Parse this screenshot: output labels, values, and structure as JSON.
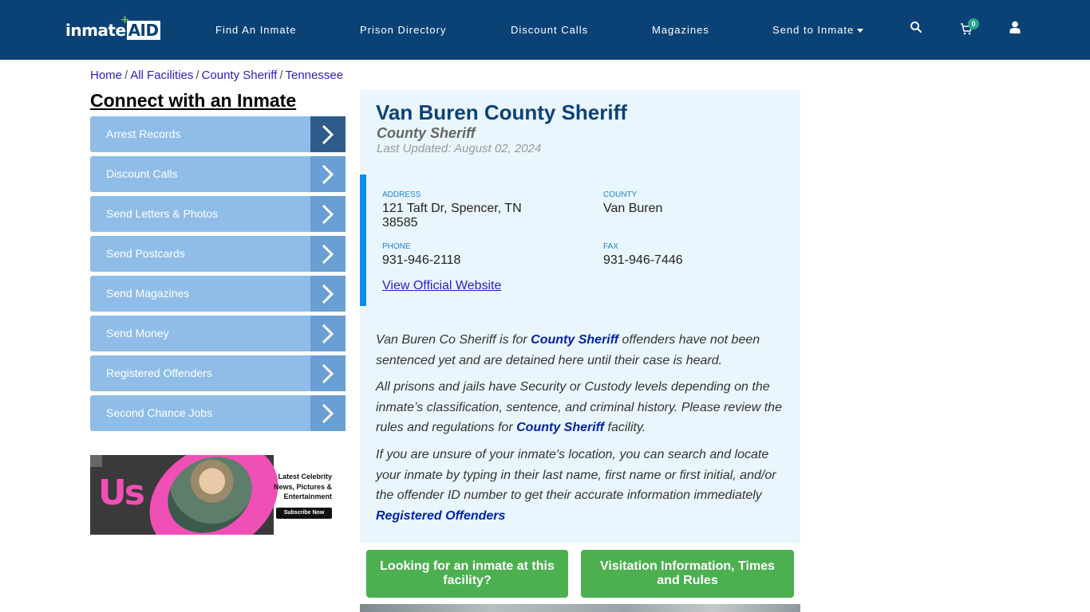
{
  "header": {
    "logo": {
      "text_main": "inmate",
      "text_aid": "AID",
      "plus": "+"
    },
    "nav": [
      {
        "label": "Find An Inmate"
      },
      {
        "label": "Prison Directory"
      },
      {
        "label": "Discount Calls"
      },
      {
        "label": "Magazines"
      },
      {
        "label": "Send to Inmate"
      }
    ],
    "icons": {
      "search": "search-icon",
      "cart": "cart-icon",
      "user": "user-icon"
    },
    "cart_count": "0"
  },
  "breadcrumb": [
    {
      "label": "Home"
    },
    {
      "label": "All Facilities"
    },
    {
      "label": "County Sheriff"
    },
    {
      "label": "Tennessee"
    }
  ],
  "breadcrumb_sep": "/",
  "sidebar": {
    "title": "Connect with an Inmate",
    "items": [
      {
        "label": "Arrest Records"
      },
      {
        "label": "Discount Calls"
      },
      {
        "label": "Send Letters & Photos"
      },
      {
        "label": "Send Postcards"
      },
      {
        "label": "Send Magazines"
      },
      {
        "label": "Send Money"
      },
      {
        "label": "Registered Offenders"
      },
      {
        "label": "Second Chance Jobs"
      }
    ],
    "ad": {
      "brand": "Us",
      "lines": [
        "Latest Celebrity",
        "News, Pictures &",
        "Entertainment"
      ],
      "cta": "Subscribe Now"
    }
  },
  "facility": {
    "name": "Van Buren County Sheriff",
    "type": "County Sheriff",
    "last_updated": "Last Updated: August 02, 2024",
    "address_label": "ADDRESS",
    "address_line1": "121 Taft Dr, Spencer, TN",
    "address_line2": "38585",
    "county_label": "COUNTY",
    "county": "Van Buren",
    "phone_label": "PHONE",
    "phone": "931-946-2118",
    "fax_label": "FAX",
    "fax": "931-946-7446",
    "website_link": "View Official Website"
  },
  "description": {
    "p1_a": "Van Buren Co Sheriff is for ",
    "p1_link": "County Sheriff",
    "p1_b": " offenders have not been sentenced yet and are detained here until their case is heard.",
    "p2_a": "All prisons and jails have Security or Custody levels depending on the inmate’s classification, sentence, and criminal history. Please review the rules and regulations for ",
    "p2_link": "County Sheriff",
    "p2_b": " facility.",
    "p3": "If you are unsure of your inmate's location, you can search and locate your inmate by typing in their last name, first name or first initial, and/or the offender ID number to get their accurate information immediately",
    "p3_link": "Registered Offenders"
  },
  "buttons": {
    "find_inmate": "Looking for an inmate at this facility?",
    "visitation": "Visitation Information, Times and Rules"
  }
}
